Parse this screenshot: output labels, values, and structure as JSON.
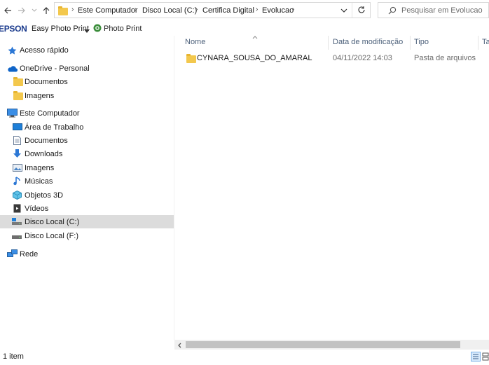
{
  "address_bar": {
    "crumbs": [
      "Este Computador",
      "Disco Local (C:)",
      "Certifica Digital",
      "Evolucao"
    ],
    "search_placeholder": "Pesquisar em Evolucao"
  },
  "epson_bar": {
    "brand": "EPSON",
    "easy_photo_print": "Easy Photo Print",
    "photo_print": "Photo Print"
  },
  "nav_pane": {
    "quick_access": "Acesso rápido",
    "onedrive": "OneDrive - Personal",
    "onedrive_items": [
      "Documentos",
      "Imagens"
    ],
    "this_pc": "Este Computador",
    "this_pc_items": [
      "Área de Trabalho",
      "Documentos",
      "Downloads",
      "Imagens",
      "Músicas",
      "Objetos 3D",
      "Vídeos",
      "Disco Local (C:)",
      "Disco Local (F:)"
    ],
    "network": "Rede"
  },
  "content": {
    "columns": [
      "Nome",
      "Data de modificação",
      "Tipo",
      "Ta"
    ],
    "rows": [
      {
        "name": "CYNARA_SOUSA_DO_AMARAL",
        "modified": "04/11/2022 14:03",
        "type": "Pasta de arquivos"
      }
    ]
  },
  "status_bar": {
    "item_count": "1 item"
  },
  "colors": {
    "folder": "#f3c84d",
    "selected_bg": "#dcdcdc",
    "header_text": "#4c607a"
  }
}
